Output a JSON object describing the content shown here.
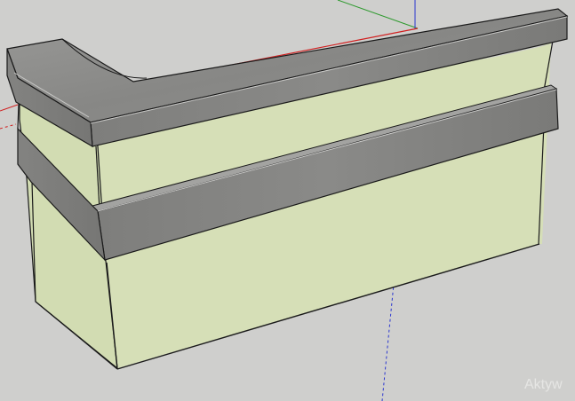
{
  "viewport": {
    "background_color": "#cfcfcd",
    "watermark_text": "Aktyw"
  },
  "model": {
    "body_color": "#d6dfb7",
    "body_side_color": "#d2dcb2",
    "concrete_color": "#8f8f8d",
    "concrete_light_color": "#a8a8a6",
    "edge_color": "#1a1a1a"
  },
  "axes": {
    "red_axis_color": "#d02020",
    "green_axis_color": "#2e9a2e",
    "blue_axis_color": "#2a35d0"
  }
}
